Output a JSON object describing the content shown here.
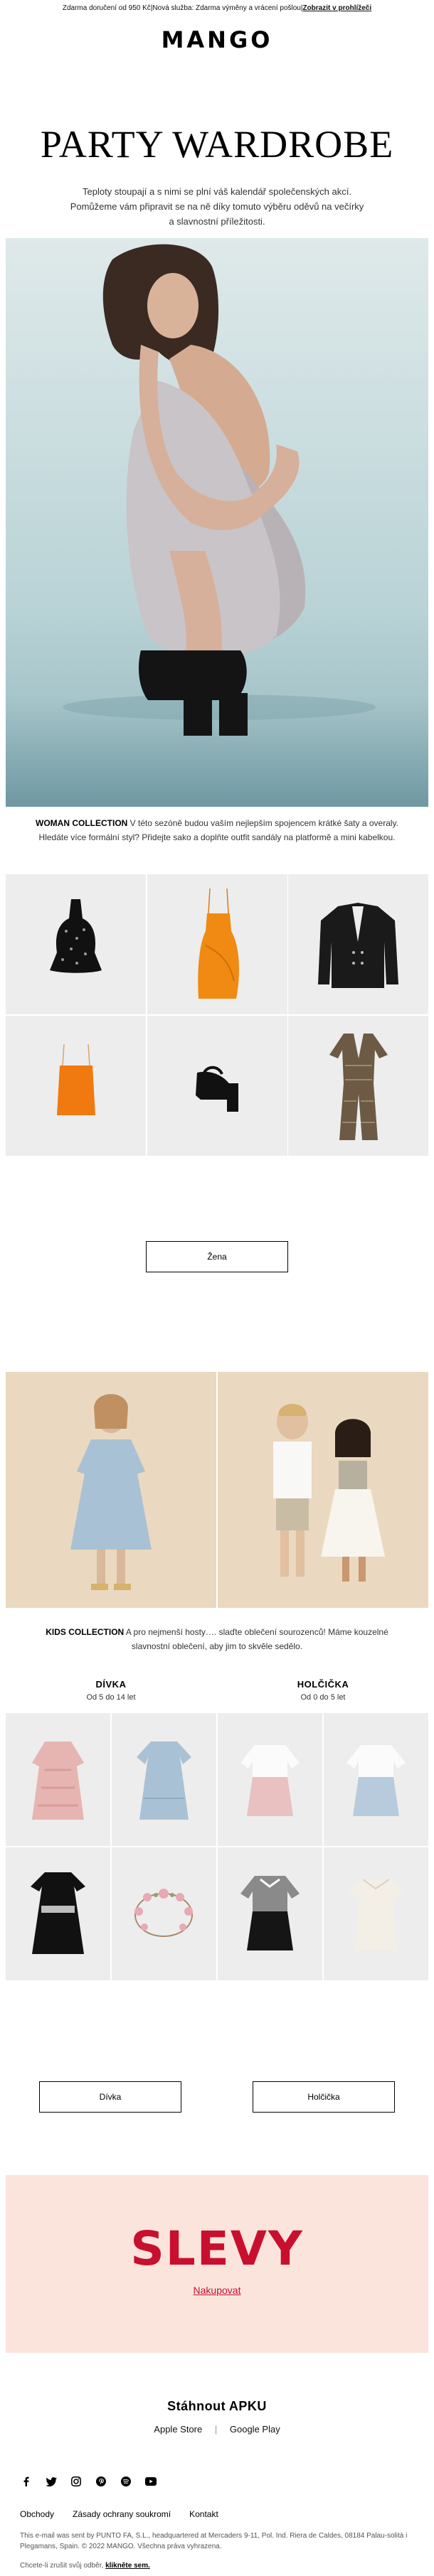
{
  "topbar": {
    "shipping": "Zdarma doručení od 950 Kč",
    "sep": " | ",
    "returns": "Nová služba: Zdarma výměny a vrácení pošlou",
    "view": "Zobrazit v prohlížeči"
  },
  "brand": {
    "logo": "MANGO"
  },
  "headline": "PARTY WARDROBE",
  "intro": "Teploty stoupají a s nimi se plní váš kalendář společenských akcí. Pomůžeme vám připravit se na ně díky tomuto výběru oděvů na večírky a slavnostní příležitosti.",
  "woman": {
    "label": "WOMAN COLLECTION",
    "text": " V této sezóně budou vaším nejlepším spojencem krátké šaty a overaly. Hledáte více formální styl? Přidejte sako a doplňte outfit sandály na platformě a mini kabelkou.",
    "button": "Žena",
    "products": [
      {
        "name": "sequin-top",
        "color": "#111111"
      },
      {
        "name": "orange-dress",
        "color": "#f08a12"
      },
      {
        "name": "black-blazer",
        "color": "#1a1a1a"
      },
      {
        "name": "orange-cami",
        "color": "#f07a10"
      },
      {
        "name": "platform-sandal",
        "color": "#111111"
      },
      {
        "name": "printed-jumpsuit",
        "color": "#6d5a45"
      }
    ]
  },
  "kids": {
    "label": "KIDS COLLECTION",
    "text": " A pro nejmenší hosty…. slaďte oblečení sourozenců! Máme kouzelné slavnostní oblečení, aby jim to skvěle sedělo.",
    "girl": {
      "title": "DÍVKA",
      "age": "Od 5 do 14 let",
      "button": "Dívka"
    },
    "baby": {
      "title": "HOLČIČKA",
      "age": "Od 0 do 5 let",
      "button": "Holčička"
    }
  },
  "sale": {
    "title": "SLEVY",
    "link": "Nakupovat"
  },
  "app": {
    "title": "Stáhnout APKU",
    "apple": "Apple Store",
    "sep": "|",
    "google": "Google Play"
  },
  "social": [
    "facebook-icon",
    "twitter-icon",
    "instagram-icon",
    "pinterest-icon",
    "spotify-icon",
    "youtube-icon"
  ],
  "footer": {
    "links": [
      "Obchody",
      "Zásady ochrany soukromí",
      "Kontakt"
    ],
    "legal": "This e-mail was sent by PUNTO FA, S.L., headquartered at Mercaders 9-11, Pol. Ind. Riera de Caldes, 08184 Palau-solità i Plegamans, Spain. © 2022 MANGO. Všechna práva vyhrazena.",
    "unsub_text": "Chcete-li zrušit svůj odběr, ",
    "unsub_link": "klikněte sem."
  },
  "colors": {
    "accent": "#c8102e",
    "sale_bg": "#fbe4dc",
    "tile_bg": "#ededed"
  }
}
